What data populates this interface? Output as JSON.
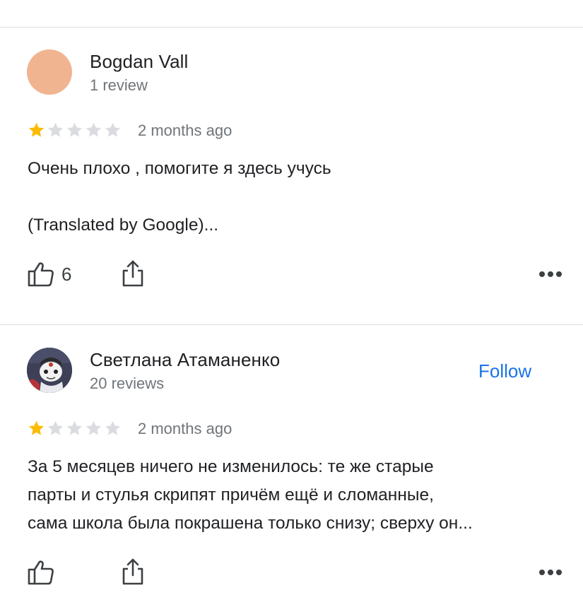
{
  "reviews": [
    {
      "author": "Bogdan Vall",
      "review_count": "1 review",
      "avatar_color": "#f1b491",
      "rating": 1,
      "time": "2 months ago",
      "text_lines": [
        "Очень плохо , помогите я здесь учусь",
        "",
        "(Translated by Google)..."
      ],
      "likes": "6",
      "has_follow": false
    },
    {
      "author": "Светлана Атаманенко",
      "review_count": "20 reviews",
      "rating": 1,
      "time": "2 months ago",
      "text_lines": [
        "За 5 месяцев ничего не изменилось: те же старые",
        "парты и стулья скрипят причём ещё и сломанные,",
        "сама школа была покрашена только снизу; сверху он..."
      ],
      "likes": "",
      "has_follow": true,
      "follow_label": "Follow"
    }
  ],
  "colors": {
    "star_filled": "#fbbc04",
    "star_empty": "#dadce0",
    "link": "#1a73e8",
    "secondary_text": "#70757a",
    "divider": "#dadce0"
  },
  "icons": [
    "thumb-up-icon",
    "share-icon",
    "more-icon",
    "star-icon"
  ]
}
